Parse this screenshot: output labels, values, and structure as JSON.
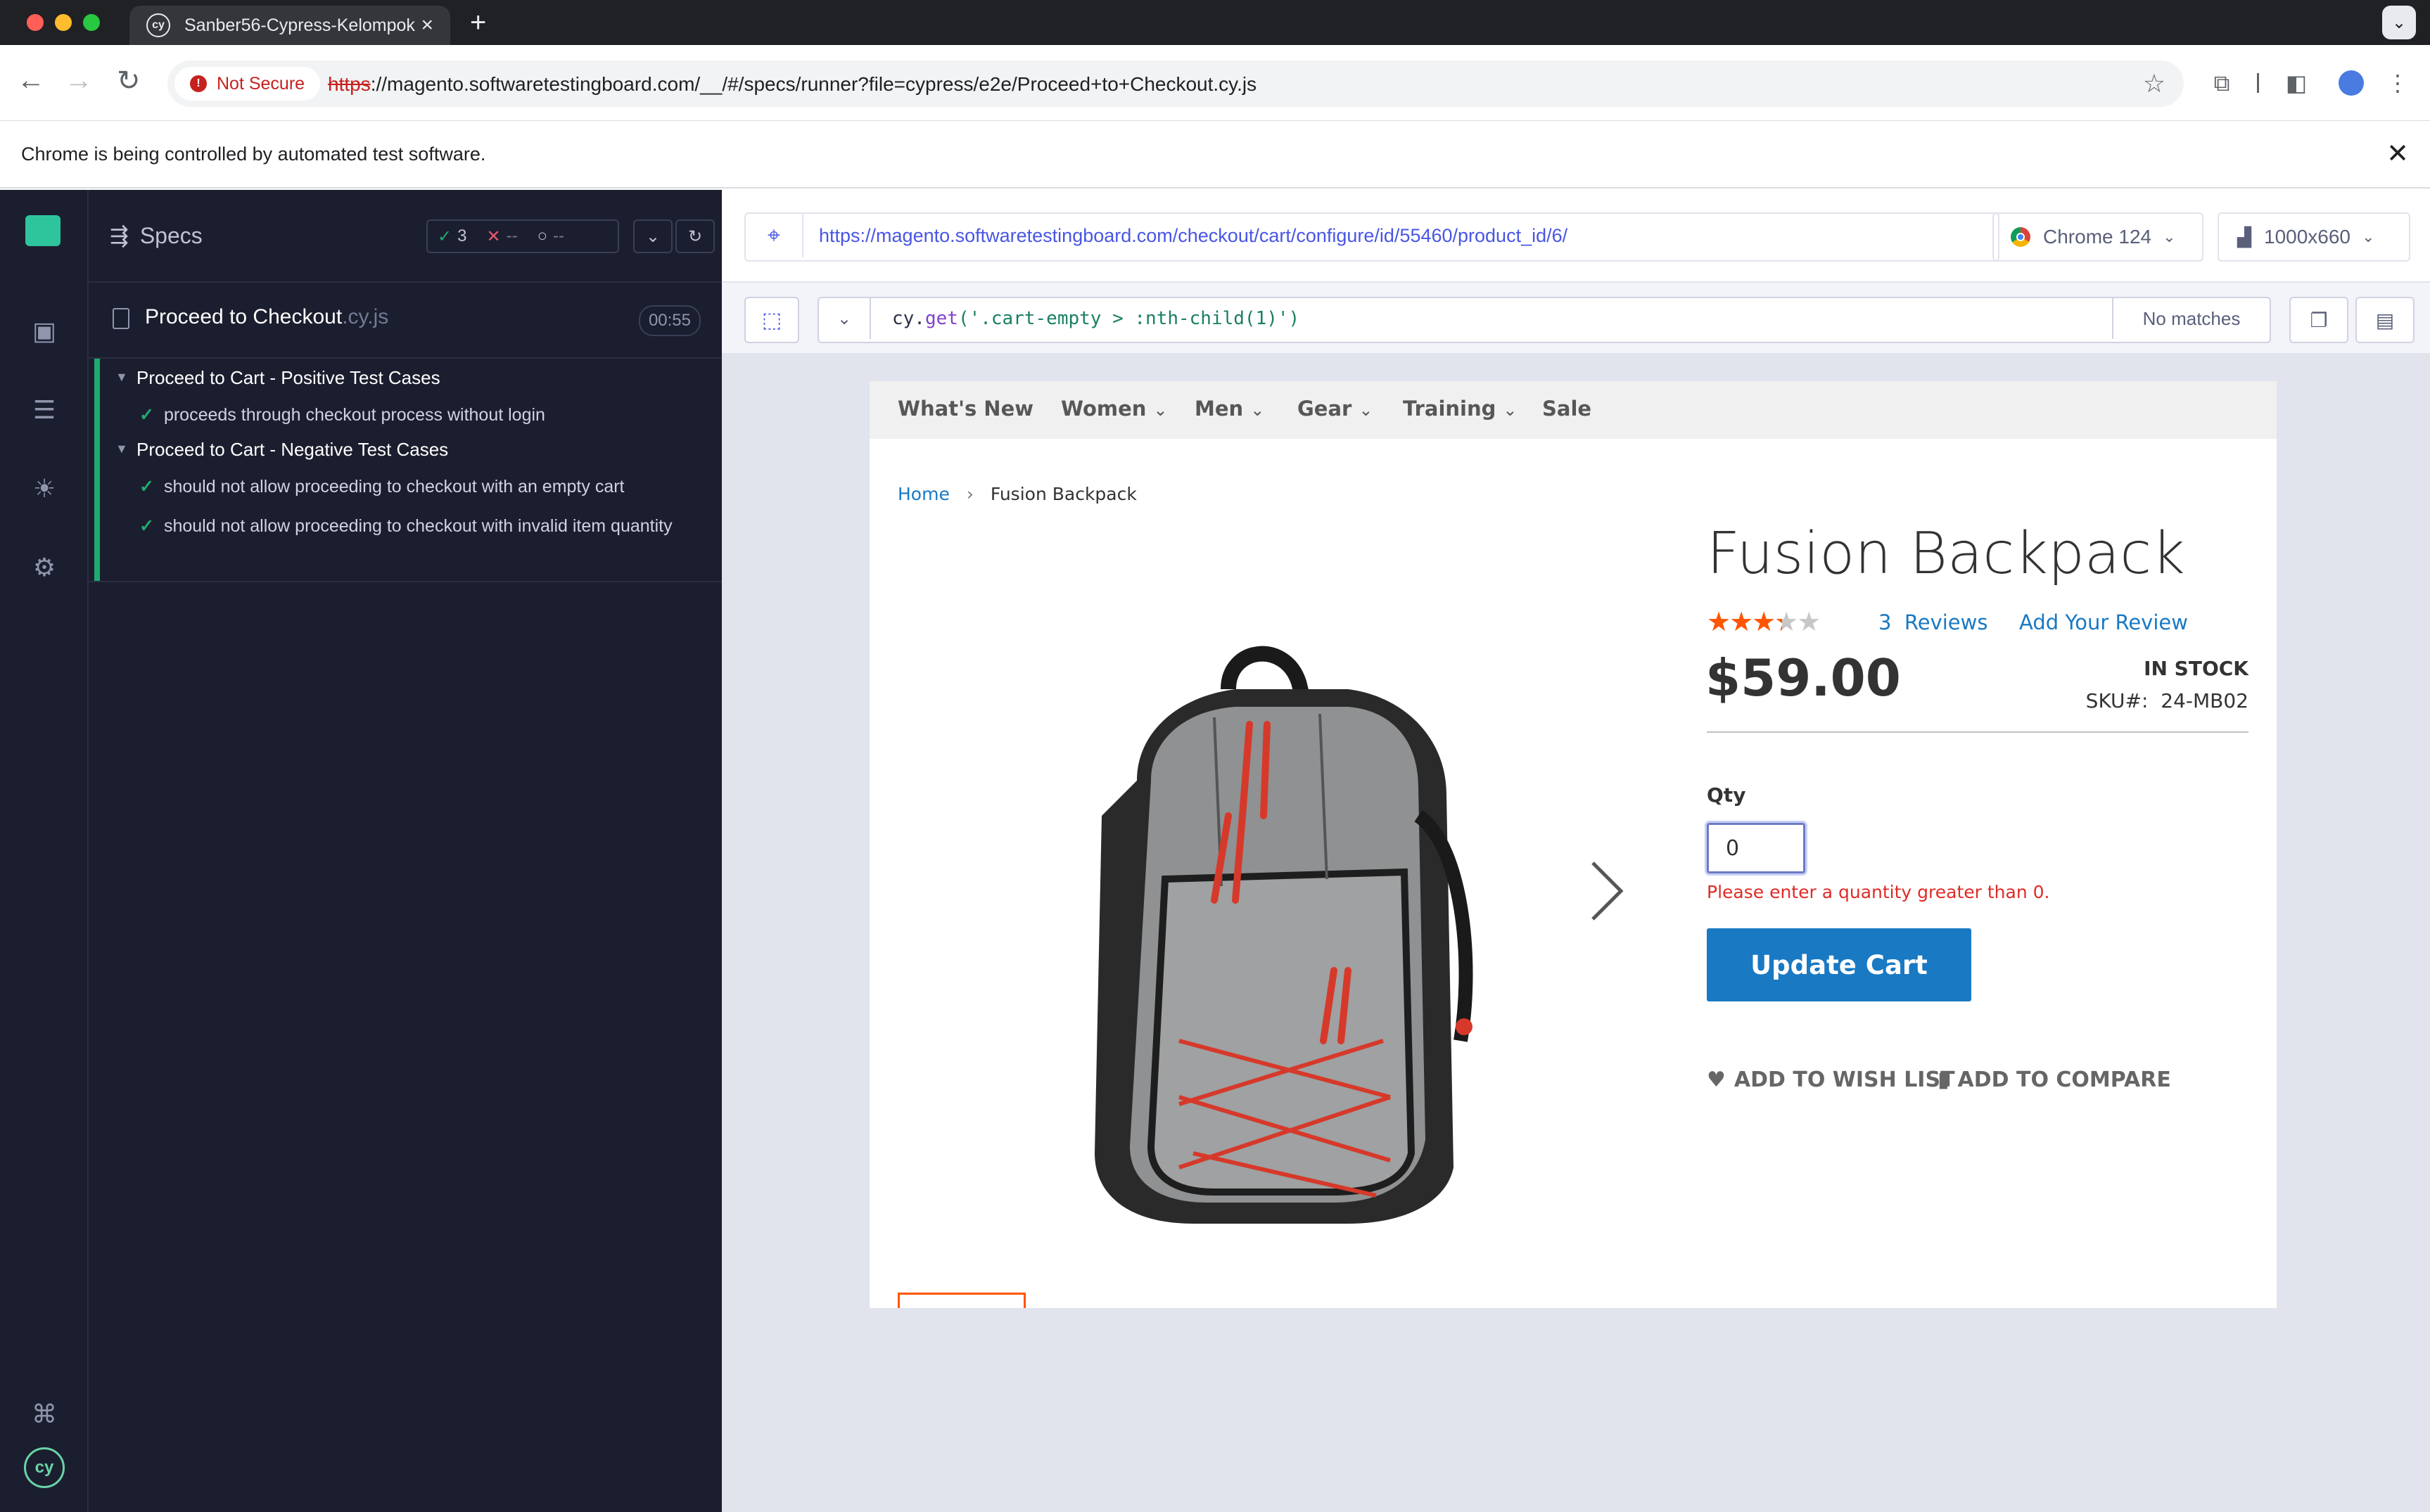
{
  "browser": {
    "tab_title": "Sanber56-Cypress-Kelompok",
    "security_label": "Not Secure",
    "url_scheme": "https",
    "url_rest": "://magento.softwaretestingboard.com/__/#/specs/runner?file=cypress/e2e/Proceed+to+Checkout.cy.js",
    "infobar_message": "Chrome is being controlled by automated test software."
  },
  "runner": {
    "specs_title": "Specs",
    "passed_count": "3",
    "failed_count": "--",
    "pending_count": "--",
    "spec_name": "Proceed to Checkout",
    "spec_ext": ".cy.js",
    "duration": "00:55",
    "suites": [
      {
        "title": "Proceed to Cart - Positive Test Cases",
        "tests": [
          "proceeds through checkout process without login"
        ]
      },
      {
        "title": "Proceed to Cart - Negative Test Cases",
        "tests": [
          "should not allow proceeding to checkout with an empty cart",
          "should not allow proceeding to checkout with invalid item quantity"
        ]
      }
    ]
  },
  "aut": {
    "url": "https://magento.softwaretestingboard.com/checkout/cart/configure/id/55460/product_id/6/",
    "browser": "Chrome 124",
    "viewport": "1000x660",
    "selector_prefix": "cy.",
    "selector_fn": "get",
    "selector_arg": "('.cart-empty > :nth-child(1)')",
    "selector_result": "No matches"
  },
  "store": {
    "nav": [
      "What's New",
      "Women",
      "Men",
      "Gear",
      "Training",
      "Sale"
    ],
    "breadcrumb_home": "Home",
    "breadcrumb_current": "Fusion Backpack",
    "product_name": "Fusion Backpack",
    "rating_percent": 67,
    "review_count": "3",
    "reviews_label": "Reviews",
    "add_review_label": "Add Your Review",
    "price": "$59.00",
    "stock": "IN STOCK",
    "sku_label": "SKU#:",
    "sku": "24-MB02",
    "qty_label": "Qty",
    "qty_value": "0",
    "qty_error": "Please enter a quantity greater than 0.",
    "update_button": "Update Cart",
    "wishlist": "ADD TO WISH LIST",
    "compare": "ADD TO COMPARE"
  },
  "colors": {
    "runner_bg": "#1b1e2e",
    "pass_green": "#1fa971",
    "magento_blue": "#1979c3",
    "error_red": "#e02b27",
    "star_orange": "#ff5501"
  }
}
